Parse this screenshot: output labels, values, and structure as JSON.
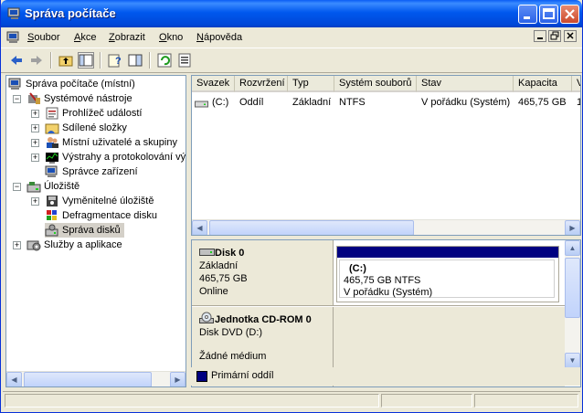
{
  "window": {
    "title": "Správa počítače"
  },
  "menu": [
    {
      "label": "Soubor",
      "u": "S",
      "rest": "oubor"
    },
    {
      "label": "Akce",
      "u": "A",
      "rest": "kce"
    },
    {
      "label": "Zobrazit",
      "u": "Z",
      "rest": "obrazit"
    },
    {
      "label": "Okno",
      "u": "O",
      "rest": "kno"
    },
    {
      "label": "Nápověda",
      "u": "N",
      "rest": "ápověda"
    }
  ],
  "tree": {
    "root": "Správa počítače (místní)",
    "system_tools": "Systémové nástroje",
    "event_viewer": "Prohlížeč událostí",
    "shared_folders": "Sdílené složky",
    "local_users": "Místní uživatelé a skupiny",
    "alerts": "Výstrahy a protokolování vý",
    "device_manager": "Správce zařízení",
    "storage": "Úložiště",
    "removable": "Vyměnitelné úložiště",
    "defrag": "Defragmentace disku",
    "disk_mgmt": "Správa disků",
    "services": "Služby a aplikace"
  },
  "volume_table": {
    "headers": [
      "Svazek",
      "Rozvržení",
      "Typ",
      "Systém souborů",
      "Stav",
      "Kapacita",
      "V"
    ],
    "rows": [
      [
        "(C:)",
        "Oddíl",
        "Základní",
        "NTFS",
        "V pořádku (Systém)",
        "465,75 GB",
        "1"
      ]
    ]
  },
  "disks": [
    {
      "name": "Disk 0",
      "type": "Základní",
      "size": "465,75 GB",
      "status": "Online",
      "partition": {
        "name": "(C:)",
        "fs": "465,75 GB NTFS",
        "state": "V pořádku (Systém)"
      }
    },
    {
      "name": "Jednotka CD-ROM 0",
      "type": "Disk DVD (D:)",
      "status": "Žádné médium"
    }
  ],
  "legend": {
    "label": "Primární oddíl",
    "color": "#000080"
  }
}
